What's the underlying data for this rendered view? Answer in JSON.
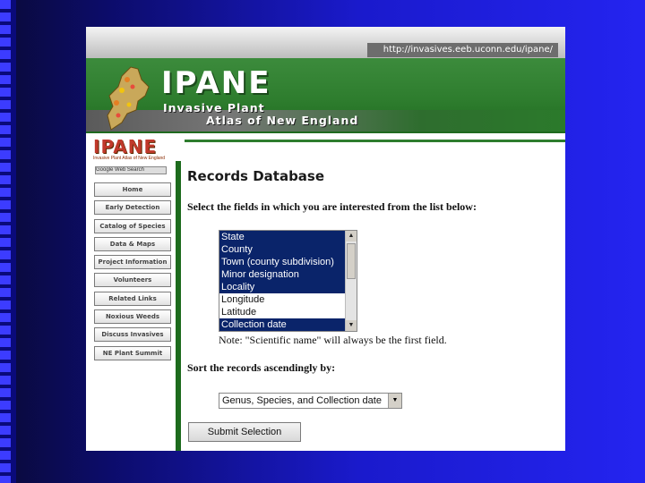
{
  "browser": {
    "url": "http://invasives.eeb.uconn.edu/ipane/"
  },
  "banner": {
    "brand": "IPANE",
    "tagline_line1": "Invasive Plant",
    "tagline_line2": "Atlas of New England",
    "logo_text": "IPANE",
    "logo_subtext": "Invasive Plant Atlas of New England",
    "map_icon": "new-england-map-icon"
  },
  "sidebar": {
    "search_label": "Google Web Search",
    "items": [
      {
        "label": "Home"
      },
      {
        "label": "Early Detection"
      },
      {
        "label": "Catalog of Species"
      },
      {
        "label": "Data & Maps"
      },
      {
        "label": "Project Information"
      },
      {
        "label": "Volunteers"
      },
      {
        "label": "Related Links"
      },
      {
        "label": "Noxious Weeds"
      },
      {
        "label": "Discuss Invasives"
      },
      {
        "label": "NE Plant Summit"
      }
    ]
  },
  "main": {
    "title": "Records Database",
    "prompt": "Select the fields in which you are interested from the list below:",
    "fields": [
      {
        "label": "State",
        "selected": true
      },
      {
        "label": "County",
        "selected": true
      },
      {
        "label": "Town (county subdivision)",
        "selected": true
      },
      {
        "label": "Minor designation",
        "selected": true
      },
      {
        "label": "Locality",
        "selected": true
      },
      {
        "label": "Longitude",
        "selected": false
      },
      {
        "label": "Latitude",
        "selected": false
      },
      {
        "label": "Collection date",
        "selected": true
      }
    ],
    "note": "Note: \"Scientific name\" will always be the first field.",
    "sort_label": "Sort the records ascendingly by:",
    "sort_value": "Genus, Species, and Collection date",
    "submit_label": "Submit Selection"
  },
  "colors": {
    "banner_green": "#2e7d2e",
    "selection_blue": "#0a246a",
    "slide_blue": "#2424f0"
  }
}
